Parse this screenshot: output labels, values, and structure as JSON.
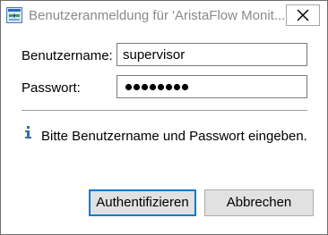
{
  "window": {
    "title": "Benutzeranmeldung für 'AristaFlow Monit...",
    "app_icon": "aristaflow-app-icon",
    "close_icon": "close-icon"
  },
  "form": {
    "username_label": "Benutzername:",
    "username_value": "supervisor",
    "password_label": "Passwort:",
    "password_masked_length": 8
  },
  "info": {
    "icon": "info-icon",
    "message": "Bitte Benutzername und Passwort eingeben."
  },
  "buttons": {
    "authenticate_label": "Authentifizieren",
    "cancel_label": "Abbrechen"
  },
  "colors": {
    "focus_border": "#0078d7",
    "button_bg": "#e1e1e1",
    "icon_blue": "#3a6ea5"
  }
}
